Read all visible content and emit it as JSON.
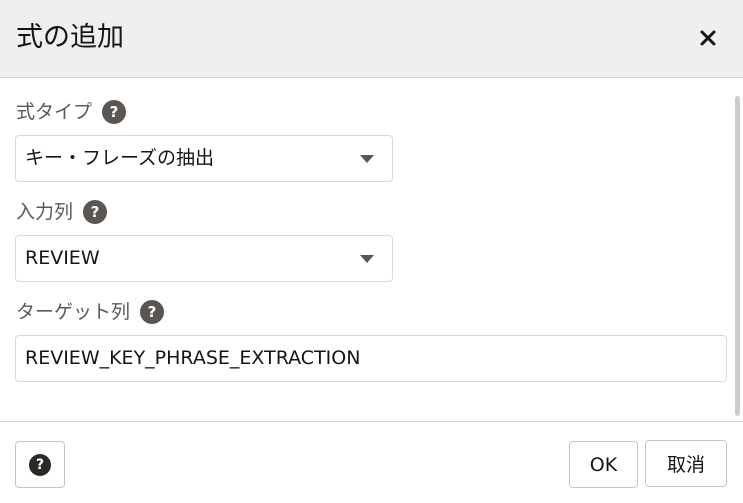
{
  "dialog": {
    "title": "式の追加",
    "close_icon": "close-icon"
  },
  "fields": {
    "expression_type": {
      "label": "式タイプ",
      "help_icon": "help-icon",
      "help_glyph": "?",
      "selected_value": "キー・フレーズの抽出"
    },
    "input_column": {
      "label": "入力列",
      "help_icon": "help-icon",
      "help_glyph": "?",
      "selected_value": "REVIEW"
    },
    "target_column": {
      "label": "ターゲット列",
      "help_icon": "help-icon",
      "help_glyph": "?",
      "value": "REVIEW_KEY_PHRASE_EXTRACTION"
    }
  },
  "footer": {
    "help_glyph": "?",
    "ok_label": "OK",
    "cancel_label": "取消"
  },
  "colors": {
    "header_bg": "#f1efed",
    "help_icon_bg": "#5b5652",
    "border": "#dcd9d5",
    "text": "#161513",
    "label_text": "#5c5955"
  }
}
